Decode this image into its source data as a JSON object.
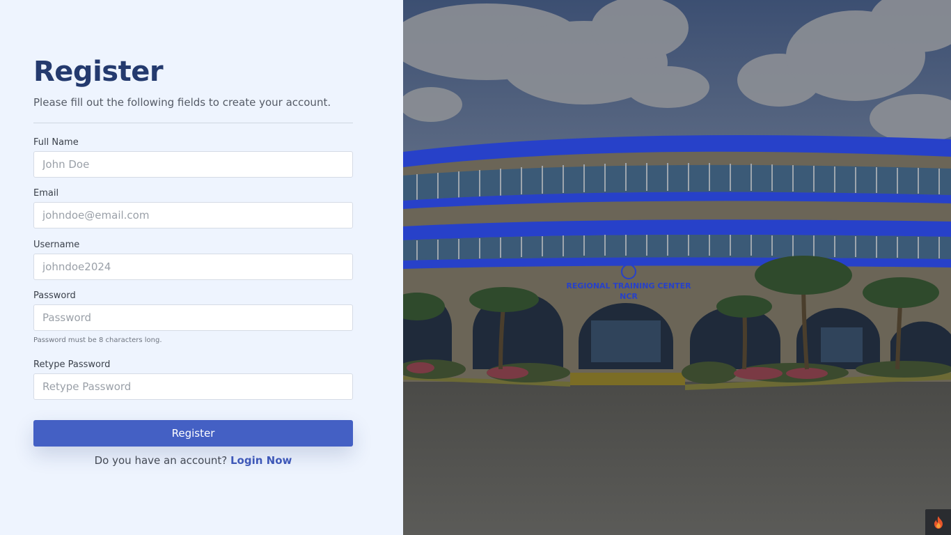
{
  "form": {
    "title": "Register",
    "subtitle": "Please fill out the following fields to create your account.",
    "fields": [
      {
        "label": "Full Name",
        "placeholder": "John Doe",
        "value": ""
      },
      {
        "label": "Email",
        "placeholder": "johndoe@email.com",
        "value": ""
      },
      {
        "label": "Username",
        "placeholder": "johndoe2024",
        "value": ""
      },
      {
        "label": "Password",
        "placeholder": "Password",
        "value": "",
        "helper": "Password must be 8 characters long."
      },
      {
        "label": "Retype Password",
        "placeholder": "Retype Password",
        "value": ""
      }
    ],
    "submit_label": "Register",
    "login_prompt": "Do you have an account?",
    "login_link": "Login Now"
  },
  "hero": {
    "sign_line1": "REGIONAL TRAINING CENTER",
    "sign_line2": "NCR"
  },
  "corner_icon": "flame-icon",
  "colors": {
    "panel_bg": "#eef4fe",
    "title": "#243a6e",
    "button": "#4460c4",
    "link": "#3e58b8",
    "building_stripe": "#2741c9"
  }
}
